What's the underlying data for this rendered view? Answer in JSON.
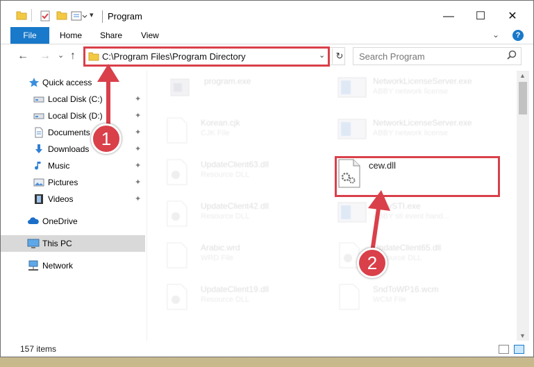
{
  "window": {
    "title": "Program",
    "minimize_glyph": "—",
    "maximize_glyph": "☐",
    "close_glyph": "✕"
  },
  "ribbon": {
    "tabs": [
      {
        "label": "File"
      },
      {
        "label": "Home"
      },
      {
        "label": "Share"
      },
      {
        "label": "View"
      }
    ],
    "expand_glyph": "⌄",
    "help_glyph": "?"
  },
  "address": {
    "path": "C:\\Program Files\\Program Directory",
    "dropdown_glyph": "⌄",
    "refresh_glyph": "↻"
  },
  "search": {
    "placeholder": "Search Program",
    "icon": "search-icon"
  },
  "nav_buttons": {
    "back": "←",
    "forward": "→",
    "recent": "⌄",
    "up": "↑"
  },
  "sidebar": {
    "items": [
      {
        "label": "Quick access",
        "icon": "star-icon",
        "pinned": false
      },
      {
        "label": "Local Disk (C:)",
        "icon": "drive-icon",
        "pinned": true
      },
      {
        "label": "Local Disk (D:)",
        "icon": "drive-icon",
        "pinned": true
      },
      {
        "label": "Documents",
        "icon": "documents-icon",
        "pinned": true
      },
      {
        "label": "Downloads",
        "icon": "download-icon",
        "pinned": true
      },
      {
        "label": "Music",
        "icon": "music-icon",
        "pinned": true
      },
      {
        "label": "Pictures",
        "icon": "pictures-icon",
        "pinned": true
      },
      {
        "label": "Videos",
        "icon": "videos-icon",
        "pinned": true
      },
      {
        "label": "OneDrive",
        "icon": "cloud-icon",
        "pinned": false
      },
      {
        "label": "This PC",
        "icon": "computer-icon",
        "pinned": false,
        "selected": true
      },
      {
        "label": "Network",
        "icon": "network-icon",
        "pinned": false
      }
    ],
    "pin_glyph": "📌"
  },
  "files": [
    {
      "name": "program.exe",
      "type": "",
      "icon": "exe-icon"
    },
    {
      "name": "NetworkLicenseServer.exe",
      "type": "ABBY network license",
      "icon": "exe-icon"
    },
    {
      "name": "Korean.cjk",
      "type": "CJK File",
      "icon": "file-icon"
    },
    {
      "name": "NetworkLicenseServer.exe",
      "type": "ABBY network license",
      "icon": "exe-icon"
    },
    {
      "name": "UpdateClient63.dll",
      "type": "Resource DLL",
      "icon": "dll-icon"
    },
    {
      "name": "cew.dll",
      "type": "",
      "icon": "dll-icon",
      "highlighted": true
    },
    {
      "name": "UpdateClient42.dll",
      "type": "Resource DLL",
      "icon": "dll-icon"
    },
    {
      "name": "AbbySTI.exe",
      "type": "ABBY sti event hand...",
      "icon": "exe-icon"
    },
    {
      "name": "Arabic.wrd",
      "type": "WRD File",
      "icon": "file-icon"
    },
    {
      "name": "UpdateClient65.dll",
      "type": "Resource DLL",
      "icon": "dll-icon"
    },
    {
      "name": "UpdateClient19.dll",
      "type": "Resource DLL",
      "icon": "dll-icon"
    },
    {
      "name": "SndToWP16.wcm",
      "type": "WCM File",
      "icon": "file-icon"
    }
  ],
  "status": {
    "item_count": "157 items"
  },
  "annotations": [
    {
      "number": "1",
      "color": "#d9404a"
    },
    {
      "number": "2",
      "color": "#d9404a"
    }
  ],
  "colors": {
    "accent": "#1979ca",
    "highlight_box": "#d9404a",
    "selected_nav": "#d9d9d9"
  }
}
